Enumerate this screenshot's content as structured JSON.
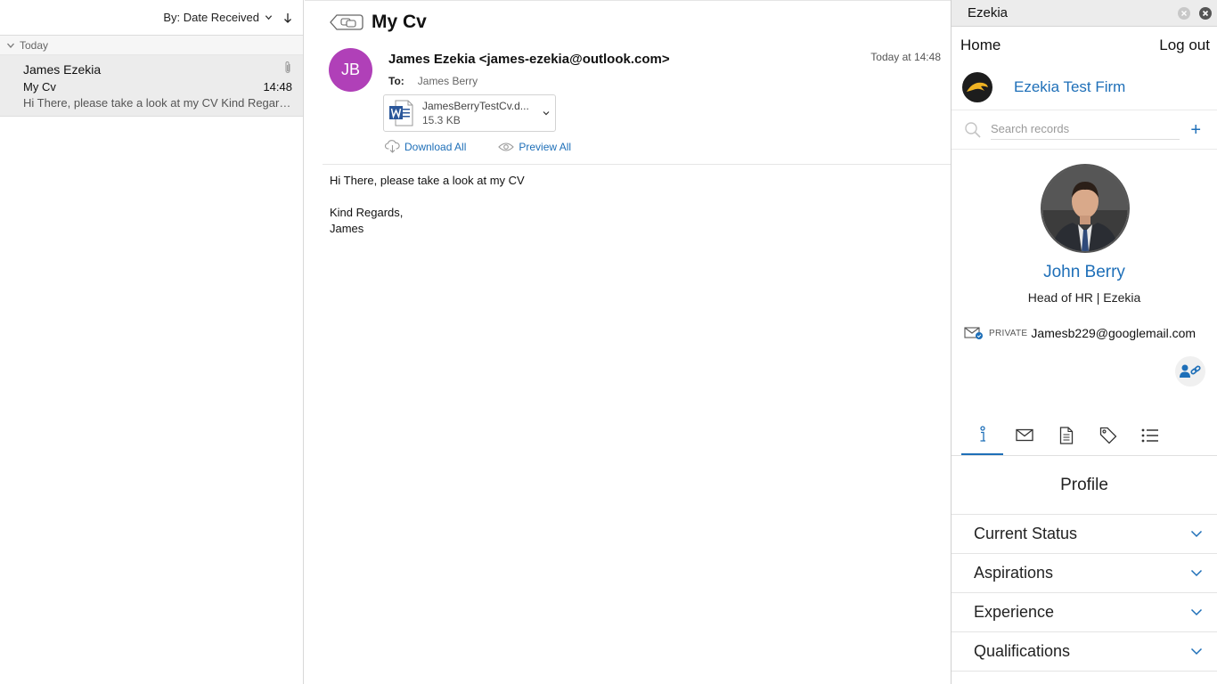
{
  "message_list": {
    "sort_label": "By: Date Received",
    "group_label": "Today",
    "items": [
      {
        "sender": "James Ezekia",
        "subject": "My Cv",
        "time": "14:48",
        "preview": "Hi There, please take a look at my CV Kind Regards, James"
      }
    ]
  },
  "email": {
    "subject": "My Cv",
    "avatar_initials": "JB",
    "avatar_color": "#b040b8",
    "from": "James Ezekia <james-ezekia@outlook.com>",
    "date": "Today at 14:48",
    "to_label": "To:",
    "to_name": "James Berry",
    "attachment": {
      "name": "JamesBerryTestCv.d...",
      "size": "15.3 KB",
      "icon": "word-doc-icon"
    },
    "download_all": "Download All",
    "preview_all": "Preview All",
    "body": {
      "line1": "Hi There, please take a look at my CV",
      "line2": "Kind Regards,",
      "line3": "James"
    }
  },
  "addin": {
    "title": "Ezekia",
    "nav": {
      "home": "Home",
      "logout": "Log out"
    },
    "firm_name": "Ezekia Test Firm",
    "search_placeholder": "Search records",
    "contact": {
      "name": "John Berry",
      "title": "Head of HR | Ezekia",
      "email_type": "PRIVATE",
      "email": "Jamesb229@googlemail.com"
    },
    "tabs": [
      {
        "icon": "info-icon"
      },
      {
        "icon": "mail-icon"
      },
      {
        "icon": "document-icon"
      },
      {
        "icon": "tag-icon"
      },
      {
        "icon": "list-icon"
      }
    ],
    "section_title": "Profile",
    "accordions": [
      "Current Status",
      "Aspirations",
      "Experience",
      "Qualifications"
    ]
  },
  "colors": {
    "accent": "#1e6fb8",
    "selected_row": "#ececec"
  }
}
